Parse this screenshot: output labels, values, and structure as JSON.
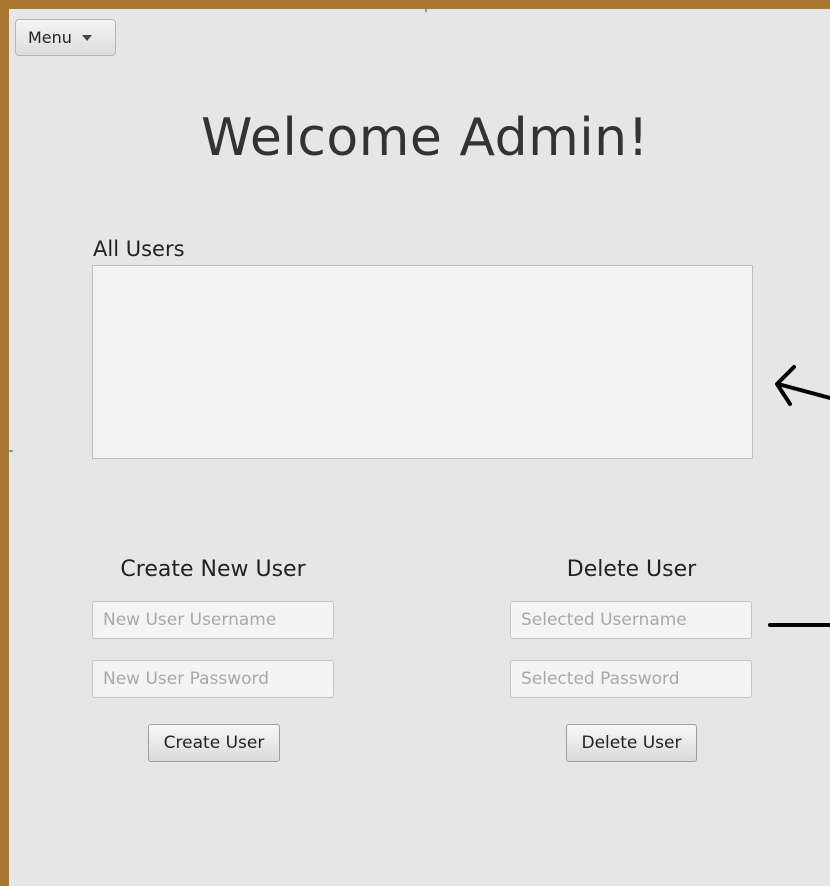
{
  "window": {
    "frame_color": "#a9772f",
    "background": "#e6e6e6"
  },
  "menu": {
    "label": "Menu",
    "icon": "caret-down-icon"
  },
  "header": {
    "title": "Welcome Admin!"
  },
  "users_panel": {
    "label": "All Users",
    "items": []
  },
  "create_user": {
    "title": "Create New User",
    "username_placeholder": "New User Username",
    "password_placeholder": "New User Password",
    "button_label": "Create User"
  },
  "delete_user": {
    "title": "Delete User",
    "username_placeholder": "Selected Username",
    "password_placeholder": "Selected Password",
    "button_label": "Delete User"
  },
  "annotations": {
    "icons": [
      "arrow-left-icon",
      "dash-line-icon"
    ],
    "color": "#000000"
  }
}
